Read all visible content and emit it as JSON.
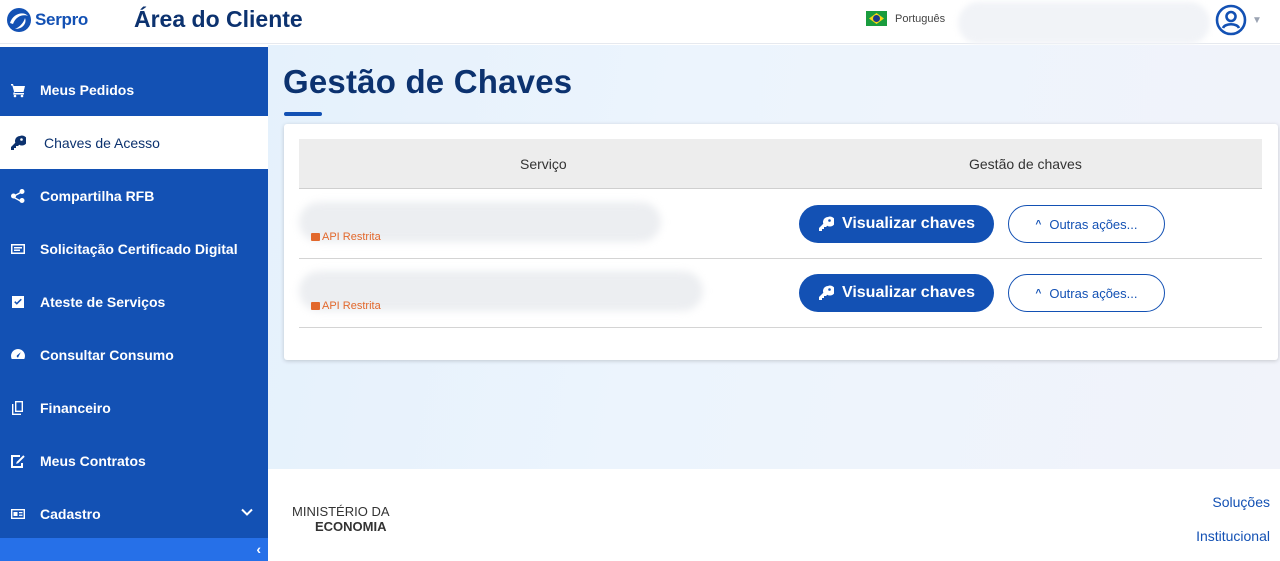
{
  "header": {
    "brand": "Serpro",
    "app_title": "Área do Cliente",
    "language": "Português"
  },
  "sidebar": {
    "items": [
      {
        "label": "Meus Pedidos",
        "icon": "cart-icon"
      },
      {
        "label": "Chaves de Acesso",
        "icon": "key-icon"
      },
      {
        "label": "Compartilha RFB",
        "icon": "share-icon"
      },
      {
        "label": "Solicitação Certificado Digital",
        "icon": "card-icon"
      },
      {
        "label": "Ateste de Serviços",
        "icon": "checkbox-icon"
      },
      {
        "label": "Consultar Consumo",
        "icon": "gauge-icon"
      },
      {
        "label": "Financeiro",
        "icon": "copy-icon"
      },
      {
        "label": "Meus Contratos",
        "icon": "signature-icon"
      },
      {
        "label": "Cadastro",
        "icon": "id-card-icon"
      }
    ],
    "active_index": 1
  },
  "main": {
    "title": "Gestão de Chaves",
    "table": {
      "columns": [
        "Serviço",
        "Gestão de chaves"
      ],
      "rows": [
        {
          "tag": "API Restrita",
          "primary_action": "Visualizar chaves",
          "secondary_action": "Outras ações..."
        },
        {
          "tag": "API Restrita",
          "primary_action": "Visualizar chaves",
          "secondary_action": "Outras ações..."
        }
      ]
    }
  },
  "footer": {
    "ministry_line1": "MINISTÉRIO DA",
    "ministry_line2": "ECONOMIA",
    "links": [
      "Soluções",
      "Institucional"
    ]
  },
  "colors": {
    "primary": "#1351b4",
    "title": "#0c326f",
    "tag": "#e2682c"
  }
}
